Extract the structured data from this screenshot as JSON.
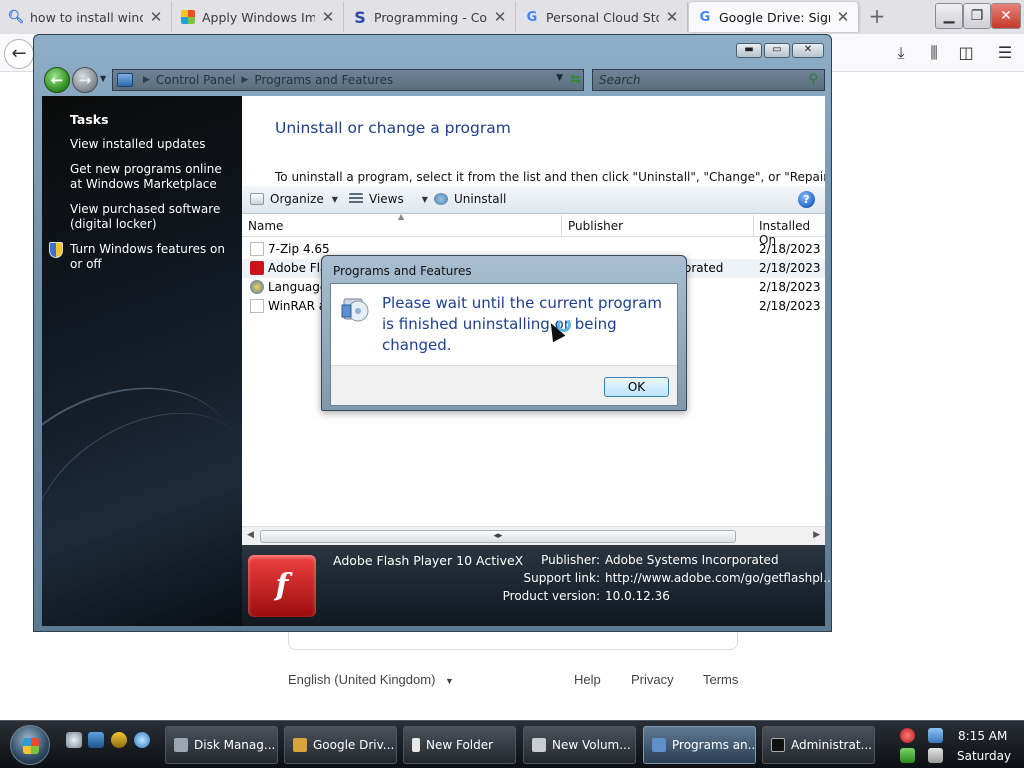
{
  "browser": {
    "tabs": [
      {
        "title": "how to install windo",
        "icon": "search-icon",
        "active": false
      },
      {
        "title": "Apply Windows Ima",
        "icon": "windows-flag-icon",
        "active": false
      },
      {
        "title": "Programming - Com",
        "icon": "s-logo-icon",
        "active": false
      },
      {
        "title": "Personal Cloud Stor",
        "icon": "google-g-icon",
        "active": false
      },
      {
        "title": "Google Drive: Sign-in",
        "icon": "google-g-icon",
        "active": true
      }
    ],
    "new_tab_label": "+"
  },
  "google_footer": {
    "language": "English (United Kingdom)",
    "help": "Help",
    "privacy": "Privacy",
    "terms": "Terms"
  },
  "explorer": {
    "breadcrumb": [
      "Control Panel",
      "Programs and Features"
    ],
    "search_placeholder": "Search",
    "tasks": {
      "heading": "Tasks",
      "links": [
        "View installed updates",
        "Get new programs online at Windows Marketplace",
        "View purchased software (digital locker)",
        "Turn Windows features on or off"
      ]
    },
    "heading": "Uninstall or change a program",
    "description": "To uninstall a program, select it from the list and then click \"Uninstall\", \"Change\", or \"Repair\".",
    "commands": {
      "organize": "Organize",
      "views": "Views",
      "uninstall": "Uninstall"
    },
    "columns": {
      "name": "Name",
      "publisher": "Publisher",
      "installed_on": "Installed On"
    },
    "rows": [
      {
        "name": "7-Zip 4.65",
        "publisher": "",
        "date": "2/18/2023"
      },
      {
        "name": "Adobe Fla",
        "publisher": "orated",
        "date": "2/18/2023"
      },
      {
        "name": "Language",
        "publisher": "",
        "date": "2/18/2023"
      },
      {
        "name": "WinRAR ar",
        "publisher": "",
        "date": "2/18/2023"
      }
    ],
    "details": {
      "title": "Adobe Flash Player 10 ActiveX",
      "publisher_label": "Publisher:",
      "publisher": "Adobe Systems Incorporated",
      "support_label": "Support link:",
      "support": "http://www.adobe.com/go/getflashpl...",
      "version_label": "Product version:",
      "version": "10.0.12.36"
    }
  },
  "dialog": {
    "title": "Programs and Features",
    "message": "Please wait until the current program is finished uninstalling or being changed.",
    "ok": "OK"
  },
  "taskbar": {
    "buttons": [
      {
        "label": "Disk Manag...",
        "active": false
      },
      {
        "label": "Google Driv...",
        "active": false
      },
      {
        "label": "New Folder",
        "active": false
      },
      {
        "label": "New Volum...",
        "active": false
      },
      {
        "label": "Programs an...",
        "active": true
      },
      {
        "label": "Administrat...",
        "active": false
      }
    ],
    "time": "8:15 AM",
    "day": "Saturday"
  },
  "colors": {
    "heading_blue": "#1e3f8a",
    "dialog_text_blue": "#1c3f94",
    "flash_red": "#d01c1c"
  }
}
